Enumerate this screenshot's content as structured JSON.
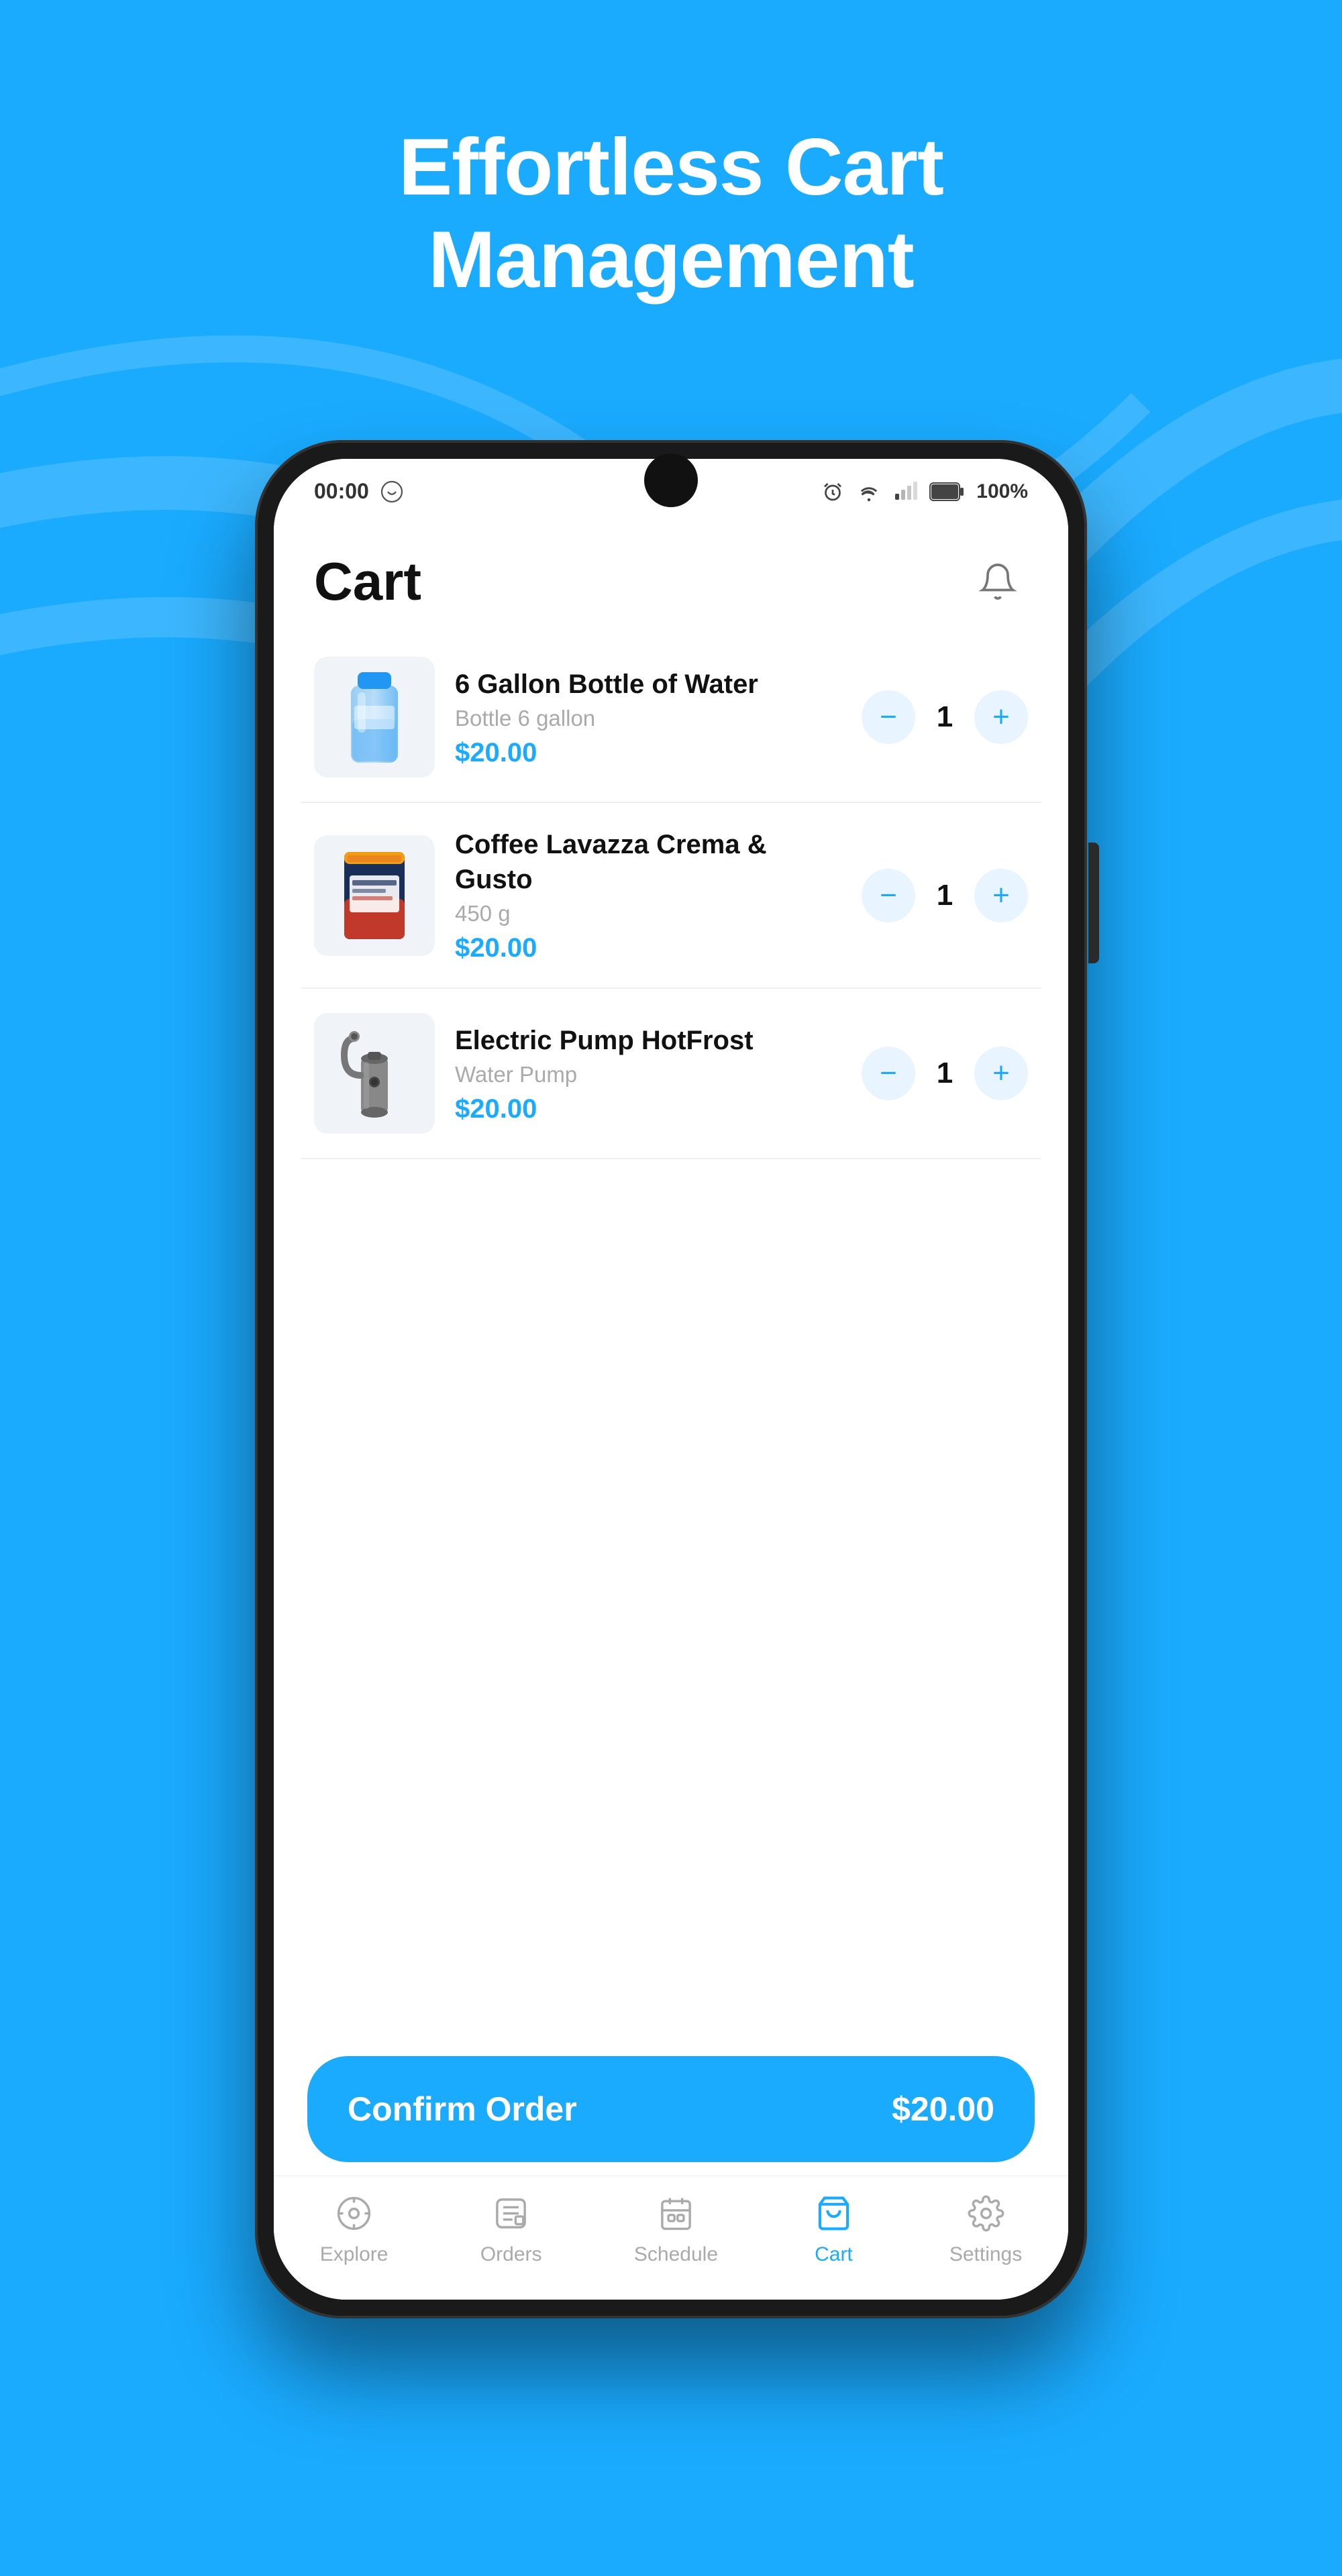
{
  "hero": {
    "title_line1": "Effortless Cart",
    "title_line2": "Management"
  },
  "status_bar": {
    "time": "00:00",
    "battery": "100%"
  },
  "app": {
    "title": "Cart",
    "notification_icon": "bell-icon"
  },
  "cart_items": [
    {
      "id": "item-1",
      "name": "6 Gallon Bottle of Water",
      "description": "Bottle 6 gallon",
      "price": "$20.00",
      "quantity": 1,
      "image_type": "water-bottle"
    },
    {
      "id": "item-2",
      "name": "Coffee Lavazza Crema & Gusto",
      "description": "450 g",
      "price": "$20.00",
      "quantity": 1,
      "image_type": "coffee"
    },
    {
      "id": "item-3",
      "name": "Electric Pump HotFrost",
      "description": "Water Pump",
      "price": "$20.00",
      "quantity": 1,
      "image_type": "pump"
    }
  ],
  "confirm_button": {
    "label": "Confirm Order",
    "price": "$20.00"
  },
  "bottom_nav": {
    "items": [
      {
        "id": "explore",
        "label": "Explore",
        "active": false
      },
      {
        "id": "orders",
        "label": "Orders",
        "active": false
      },
      {
        "id": "schedule",
        "label": "Schedule",
        "active": false
      },
      {
        "id": "cart",
        "label": "Cart",
        "active": true
      },
      {
        "id": "settings",
        "label": "Settings",
        "active": false
      }
    ]
  }
}
